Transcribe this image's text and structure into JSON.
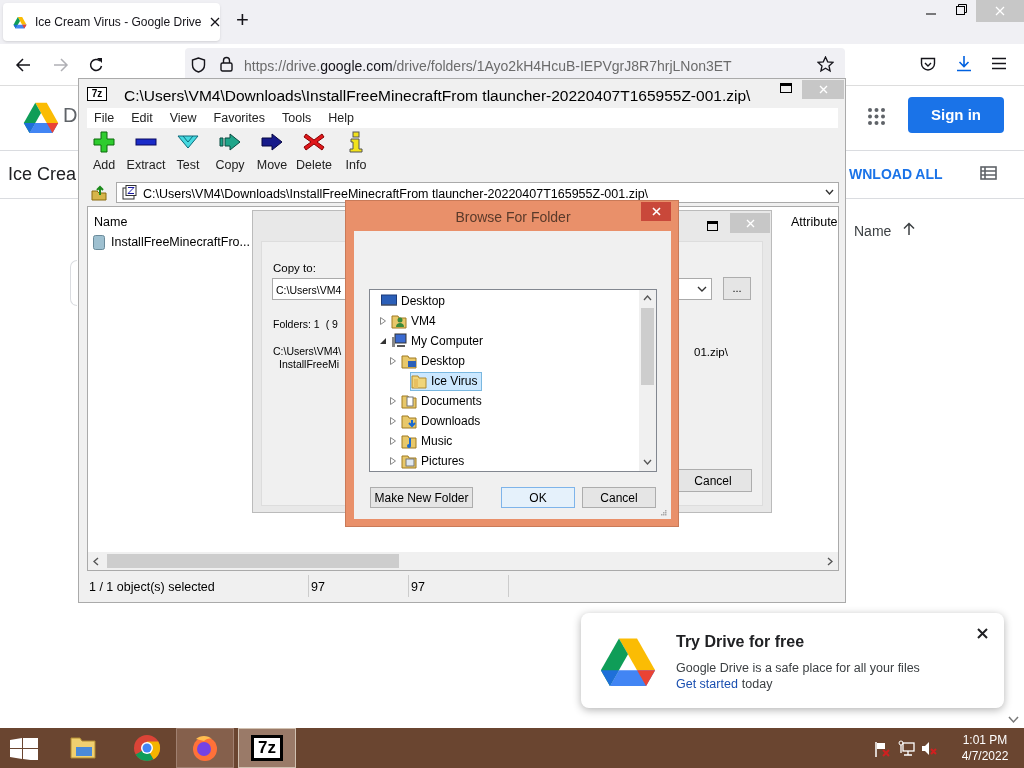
{
  "browser": {
    "tab": {
      "title": "Ice Cream Virus - Google Drive",
      "selected": true
    },
    "new_tab": "+",
    "url": {
      "prefix": "https://drive.",
      "host": "google.com",
      "path": "/drive/folders/1Ayo2kH4HcuB-IEPVgrJ8R7hrjLNon3ET"
    }
  },
  "drive": {
    "logo_text": "D",
    "sign_in": "Sign in",
    "folder_title": "Ice Crea",
    "download_all": "WNLOAD ALL",
    "sort_column": "Name"
  },
  "toast": {
    "title": "Try Drive for free",
    "body": "Google Drive is a safe place for all your files",
    "link": "Get started",
    "after": "today"
  },
  "sevenzip": {
    "title_icon": "7z",
    "title": "C:\\Users\\VM4\\Downloads\\InstallFreeMinecraftFrom tlauncher-20220407T165955Z-001.zip\\",
    "menu": [
      "File",
      "Edit",
      "View",
      "Favorites",
      "Tools",
      "Help"
    ],
    "tools": [
      {
        "kind": "add",
        "label": "Add"
      },
      {
        "kind": "extract",
        "label": "Extract"
      },
      {
        "kind": "test",
        "label": "Test"
      },
      {
        "kind": "copy",
        "label": "Copy"
      },
      {
        "kind": "move",
        "label": "Move"
      },
      {
        "kind": "delete",
        "label": "Delete"
      },
      {
        "kind": "info",
        "label": "Info"
      }
    ],
    "address": "C:\\Users\\VM4\\Downloads\\InstallFreeMinecraftFrom tlauncher-20220407T165955Z-001.zip\\",
    "columns": [
      "Name",
      "Attribute"
    ],
    "rows": [
      {
        "name": "InstallFreeMinecraftFro..."
      }
    ],
    "status": [
      "1 / 1 object(s) selected",
      "97",
      "97"
    ]
  },
  "copy_dialog": {
    "copy_to_label": "Copy to:",
    "path": "C:\\Users\\VM4",
    "browse": "...",
    "folders": "Folders: 1",
    "size": "( 9",
    "path_line_1": "C:\\Users\\VM4\\",
    "path_line_2": "InstallFreeMi",
    "path_tail": "01.zip\\",
    "cancel": "Cancel"
  },
  "browse_dialog": {
    "title": "Browse For Folder",
    "tree": [
      {
        "label": "Desktop",
        "kind": "desktop",
        "selected": false,
        "children": [
          {
            "label": "VM4",
            "kind": "user",
            "expanded": false,
            "selected": false
          },
          {
            "label": "My Computer",
            "kind": "computer",
            "expanded": true,
            "selected": false,
            "children": [
              {
                "label": "Desktop",
                "kind": "desktop-folder",
                "expanded": false,
                "selected": false,
                "children": [
                  {
                    "label": "Ice Virus",
                    "kind": "folder",
                    "selected": true
                  }
                ]
              },
              {
                "label": "Documents",
                "kind": "documents",
                "expanded": false,
                "selected": false
              },
              {
                "label": "Downloads",
                "kind": "downloads",
                "expanded": false,
                "selected": false
              },
              {
                "label": "Music",
                "kind": "music",
                "expanded": false,
                "selected": false
              },
              {
                "label": "Pictures",
                "kind": "pictures",
                "expanded": false,
                "selected": false
              }
            ]
          }
        ]
      }
    ],
    "buttons": [
      {
        "label": "Make New Folder",
        "default": false
      },
      {
        "label": "OK",
        "default": true
      },
      {
        "label": "Cancel",
        "default": false
      }
    ]
  },
  "taskbar": {
    "apps": [
      {
        "kind": "explorer",
        "running": false,
        "selected": false
      },
      {
        "kind": "chrome",
        "running": false,
        "selected": false
      },
      {
        "kind": "firefox",
        "running": true,
        "selected": false
      },
      {
        "kind": "sevenzip",
        "selected": true,
        "text": "7z"
      }
    ],
    "time": "1:01 PM",
    "date": "4/7/2022"
  }
}
